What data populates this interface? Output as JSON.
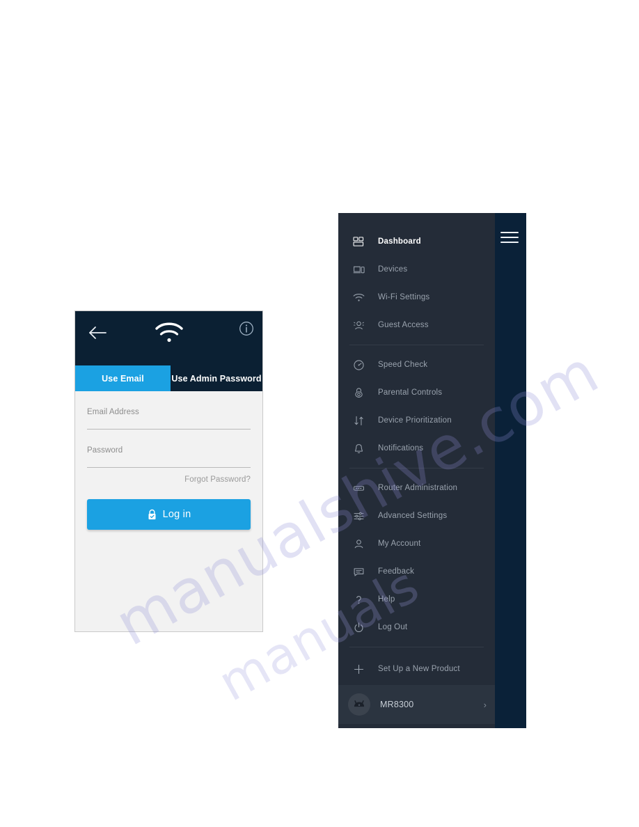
{
  "login": {
    "header": {
      "back_icon": "back-arrow-icon",
      "brand_icon": "wifi-icon",
      "info_icon": "info-icon"
    },
    "tabs": [
      {
        "label": "Use Email",
        "active": true
      },
      {
        "label": "Use Admin Password",
        "active": false
      }
    ],
    "fields": [
      {
        "label": "Email Address",
        "value": ""
      },
      {
        "label": "Password",
        "value": ""
      }
    ],
    "forgot_password": "Forgot Password?",
    "login_button": {
      "label": "Log in",
      "icon": "lock-check-icon"
    },
    "colors": {
      "header_bg": "#0b2033",
      "accent": "#1ba1e2",
      "form_bg": "#f2f2f2"
    }
  },
  "drawer": {
    "menu_icon": "hamburger-icon",
    "groups": [
      {
        "items": [
          {
            "label": "Dashboard",
            "icon": "dashboard-icon",
            "active": true
          },
          {
            "label": "Devices",
            "icon": "devices-icon",
            "active": false
          },
          {
            "label": "Wi-Fi Settings",
            "icon": "wifi-icon",
            "active": false
          },
          {
            "label": "Guest Access",
            "icon": "guest-access-icon",
            "active": false
          }
        ]
      },
      {
        "items": [
          {
            "label": "Speed Check",
            "icon": "speedometer-icon",
            "active": false
          },
          {
            "label": "Parental Controls",
            "icon": "lock-icon",
            "active": false
          },
          {
            "label": "Device Prioritization",
            "icon": "up-down-arrows-icon",
            "active": false
          },
          {
            "label": "Notifications",
            "icon": "bell-icon",
            "active": false
          }
        ]
      },
      {
        "items": [
          {
            "label": "Router Administration",
            "icon": "router-icon",
            "active": false
          },
          {
            "label": "Advanced Settings",
            "icon": "sliders-icon",
            "active": false
          },
          {
            "label": "My Account",
            "icon": "person-icon",
            "active": false
          },
          {
            "label": "Feedback",
            "icon": "chat-icon",
            "active": false
          },
          {
            "label": "Help",
            "icon": "question-mark-icon",
            "active": false
          },
          {
            "label": "Log Out",
            "icon": "power-icon",
            "active": false
          }
        ]
      },
      {
        "items": [
          {
            "label": "Set Up a New Product",
            "icon": "plus-icon",
            "active": false
          }
        ]
      }
    ],
    "device": {
      "name": "MR8300",
      "avatar_icon": "router-thumbnail-icon",
      "chevron": "›"
    },
    "colors": {
      "drawer_bg": "#242c38",
      "backdrop_bg": "#0a2138",
      "device_row_bg": "#2b3440"
    }
  },
  "watermark": {
    "line1": "manualshive.com",
    "line2": "manuals"
  }
}
